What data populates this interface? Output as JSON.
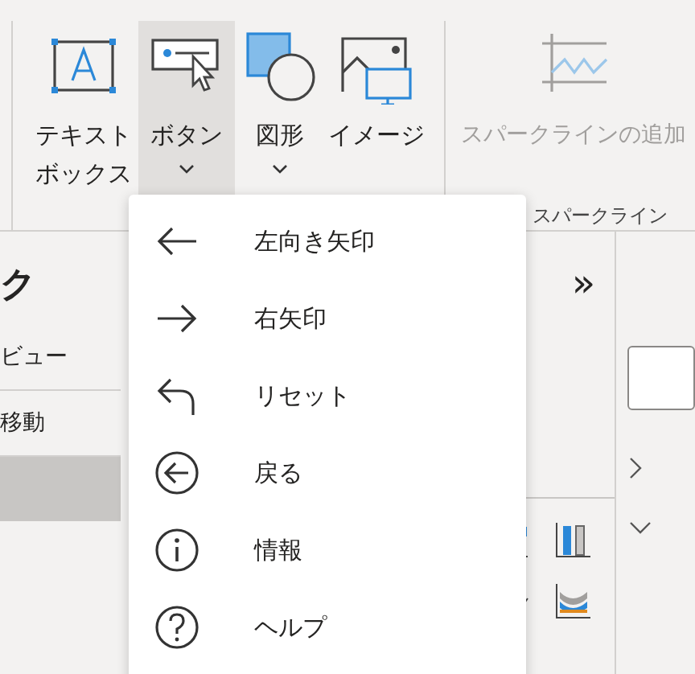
{
  "ribbon": {
    "buttons": [
      {
        "kind": "textbox",
        "lines": [
          "テキスト",
          "ボックス"
        ],
        "dropdown": false,
        "selected": false
      },
      {
        "kind": "button",
        "lines": [
          "ボタン"
        ],
        "dropdown": true,
        "selected": true
      },
      {
        "kind": "shapes",
        "lines": [
          "図形"
        ],
        "dropdown": true,
        "selected": false
      },
      {
        "kind": "image",
        "lines": [
          "イメージ"
        ],
        "dropdown": false,
        "selected": false
      }
    ],
    "sparkline_button": {
      "label": "スパークラインの追加",
      "disabled": true
    },
    "group_label": "スパークライン"
  },
  "left_pane": {
    "title": "ク",
    "items": [
      {
        "label": "ビュー",
        "selected": false
      },
      {
        "label": "移動",
        "selected": false
      },
      {
        "selected": true
      }
    ]
  },
  "canvas": {
    "expand": "»"
  },
  "menu": {
    "items": [
      {
        "kind": "left-arrow",
        "label": "左向き矢印"
      },
      {
        "kind": "right-arrow",
        "label": "右矢印"
      },
      {
        "kind": "reset",
        "label": "リセット"
      },
      {
        "kind": "back",
        "label": "戻る"
      },
      {
        "kind": "info",
        "label": "情報"
      },
      {
        "kind": "help",
        "label": "ヘルプ"
      }
    ]
  }
}
